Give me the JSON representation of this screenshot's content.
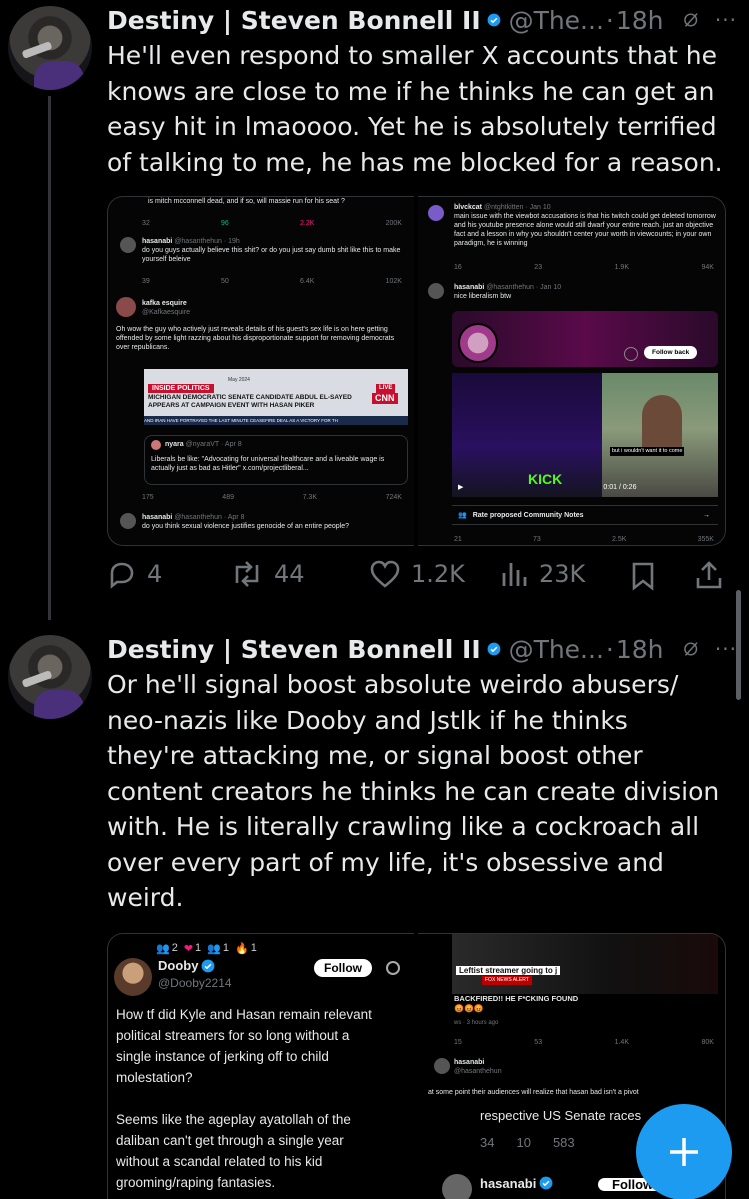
{
  "tweet1": {
    "author_name": "Destiny | Steven Bonnell II",
    "handle": "@The...",
    "separator": "·",
    "time": "18h",
    "more": "···",
    "text_lines": [
      "He'll even respond to smaller X accounts that he",
      "knows are close to me if he thinks he can get an",
      "easy hit in lmaoooo. Yet he is absolutely terrified",
      "of talking to me, he has me blocked for a reason."
    ],
    "actions": {
      "replies": "4",
      "reposts": "44",
      "likes": "1.2K",
      "views": "23K"
    },
    "media_left": {
      "top_line": "is mitch mcconnell dead, and if so, will massie run for his seat ?",
      "stats1": [
        "32",
        "96",
        "2.2K",
        "200K"
      ],
      "hasan1": {
        "name": "hasanabi",
        "handle": "@hasanthehun · 19h",
        "text": "do you guys actually believe this shit? or do you just say dumb shit like this to make yourself beleive",
        "stats": [
          "39",
          "50",
          "6.4K",
          "102K"
        ]
      },
      "kafka": {
        "name": "kafka esquire",
        "handle": "@Kafkaesquire",
        "text": "Oh wow the guy who actively just reveals details of his guest's sex life is on here getting offended by some light razzing about his disproportionate support for removing democrats over republicans."
      },
      "cnn": {
        "label": "INSIDE POLITICS",
        "date": "May 2024",
        "live": "LIVE",
        "logo": "CNN",
        "headline1": "MICHIGAN DEMOCRATIC SENATE CANDIDATE ABDUL EL-SAYED",
        "headline2": "APPEARS AT CAMPAIGN EVENT WITH HASAN PIKER",
        "ticker": "AND IRAN HAVE PORTRAYED THE LAST MINUTE CEASEFIRE DEAL AS A VICTORY FOR TH"
      },
      "nyara": {
        "name": "nyara",
        "handle": "@nyaraVT · Apr 8",
        "text": "Liberals be like: \"Advocating for universal healthcare and a liveable wage is actually just as bad as Hitler\" x.com/projectliberal..."
      },
      "stats2": [
        "175",
        "489",
        "7.3K",
        "724K"
      ],
      "hasan2": {
        "name": "hasanabi",
        "handle": "@hasanthehun · Apr 8",
        "text": "do you think sexual violence justifies genocide of an entire people?"
      }
    },
    "media_right": {
      "blvck": {
        "name": "blvckcat",
        "handle": "@ntghtkitten · Jan 10",
        "text": "main issue with the viewbot accusations is that his twitch could get deleted tomorrow and his youtube presence alone would still dwarf your entire reach. just an objective fact and a lesson in why you shouldn't center your worth in viewcounts; in your own paradigm, he is winning",
        "stats": [
          "16",
          "23",
          "1.9K",
          "94K"
        ]
      },
      "hasan": {
        "name": "hasanabi",
        "handle": "@hasanthehun · Jan 10",
        "text": "nice liberalism btw"
      },
      "follow_back": "Follow back",
      "kick": "KICK",
      "caption": "but i wouldn't want it to come",
      "video_time": "0:01 / 0:26",
      "notes": "Rate proposed Community Notes",
      "stats": [
        "21",
        "73",
        "2.5K",
        "355K"
      ]
    }
  },
  "tweet2": {
    "author_name": "Destiny | Steven Bonnell II",
    "handle": "@The...",
    "separator": "·",
    "time": "18h",
    "more": "···",
    "text_lines": [
      "Or he'll signal boost absolute weirdo abusers/",
      "neo-nazis like Dooby and Jstlk if he thinks",
      "they're attacking me, or signal boost other",
      "content creators he thinks he can create division",
      "with. He is literally crawling like a cockroach all",
      "over every part of my life, it's obsessive and",
      "weird."
    ],
    "media_left": {
      "notif_counts": [
        "2",
        "1",
        "1",
        "1"
      ],
      "name": "Dooby",
      "handle": "@Dooby2214",
      "follow": "Follow",
      "para1": [
        "How tf did Kyle and Hasan remain relevant",
        "political streamers for so long without a",
        "single instance of jerking off to child",
        "molestation?"
      ],
      "para2": [
        "Seems like the ageplay ayatollah of the",
        "daliban can't get through a single year",
        "without a scandal related to his kid",
        "grooming/raping fantasies."
      ]
    },
    "media_right": {
      "fox_top": "Leftist streamer going to j",
      "fox_banner": "FOX NEWS ALERT",
      "fox_headline": "BACKFIRED!! HE F*CKING FOUND",
      "fox_emojis": "😡😡😡",
      "fox_time": "ws · 3 hours ago",
      "stats": [
        "15",
        "53",
        "1.4K",
        "80K"
      ],
      "hasan_name": "hasanabi",
      "hasan_handle": "@hasanthehun",
      "hasan_text": "at some point their audiences will realize that hasan bad isn't a pivot",
      "senate": "respective US Senate races",
      "bottom_stats": [
        "34",
        "10",
        "583"
      ],
      "bottom_name": "hasanabi",
      "bottom_follow": "Follow"
    }
  },
  "colors": {
    "background": "#000000",
    "text": "#e7e9ea",
    "muted": "#71767b",
    "accent": "#1d9bf0",
    "verified": "#1d9bf0"
  },
  "fab_icon": "plus-icon"
}
